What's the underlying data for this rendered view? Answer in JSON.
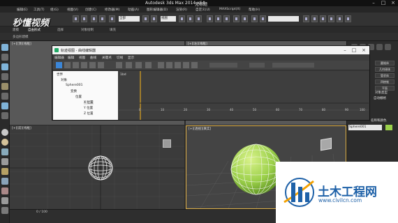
{
  "window": {
    "title": "Autodesk 3ds Max  2014 x64",
    "filename": "无标题"
  },
  "menubar": [
    "编辑(E)",
    "工具(T)",
    "组(G)",
    "视图(V)",
    "创建(C)",
    "修改器(M)",
    "动画(A)",
    "图形编辑器(D)",
    "渲染(R)",
    "自定义(U)",
    "MAXScript(X)",
    "帮助(H)"
  ],
  "ribbon": [
    "建模",
    "自由形式",
    "选择",
    "对象绘制",
    "填充"
  ],
  "ribbon_sub": [
    "多边形建模"
  ],
  "toolbar": {
    "filter_value": "全部",
    "view_value": "视图"
  },
  "logo": {
    "text": "秒懂视频"
  },
  "viewports": {
    "top_left": "[+][顶][线框]",
    "top_right": "[+][左][线框]",
    "front": "[+][前][线框]",
    "persp": "[+][透视][真实]"
  },
  "curve_editor": {
    "title": "轨迹视图 - 曲线编辑器",
    "menus": [
      "编辑器",
      "编辑",
      "视图",
      "曲线",
      "关键点",
      "切线",
      "显示"
    ],
    "tree": {
      "world": "世界",
      "objects": "对象",
      "sphere": "Sphere001",
      "transform": "变换",
      "position": "位置",
      "x": "X 位置",
      "y": "Y 位置",
      "z": "Z 位置"
    },
    "ruler": [
      "0",
      "10",
      "20",
      "30",
      "40",
      "50",
      "60",
      "70",
      "80",
      "90",
      "100"
    ],
    "graph_label": "1bd"
  },
  "command_panel": {
    "category": "对象类型",
    "autogrid": "自动栅格",
    "buttons": [
      "圆锥体",
      "几何球体",
      "管状体",
      "四棱锥",
      "平面"
    ],
    "section": "名称和颜色",
    "object_name": "Sphere001",
    "object_color": "#9ad04a"
  },
  "timeline": {
    "frame": "0 / 100"
  },
  "watermark": {
    "title": "土木工程网",
    "url": "www.civilcn.com"
  }
}
